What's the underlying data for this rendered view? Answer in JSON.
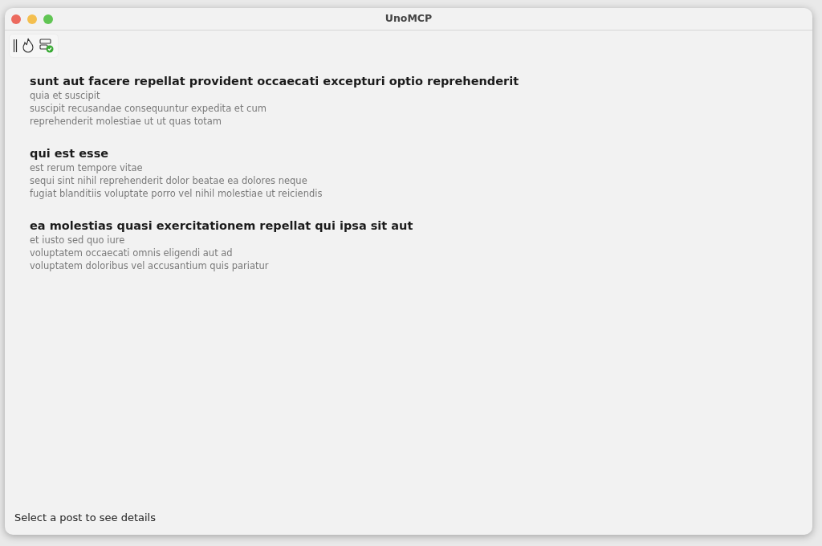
{
  "window": {
    "title": "UnoMCP"
  },
  "posts": [
    {
      "title": "sunt aut facere repellat provident occaecati excepturi optio reprehenderit",
      "body": [
        "quia et suscipit",
        "suscipit recusandae consequuntur expedita et cum",
        "reprehenderit molestiae ut ut quas totam"
      ]
    },
    {
      "title": "qui est esse",
      "body": [
        "est rerum tempore vitae",
        "sequi sint nihil reprehenderit dolor beatae ea dolores neque",
        "fugiat blanditiis voluptate porro vel nihil molestiae ut reiciendis"
      ]
    },
    {
      "title": "ea molestias quasi exercitationem repellat qui ipsa sit aut",
      "body": [
        "et iusto sed quo iure",
        "voluptatem occaecati omnis eligendi aut ad",
        "voluptatem doloribus vel accusantium quis pariatur"
      ]
    }
  ],
  "status": "Select a post to see details"
}
